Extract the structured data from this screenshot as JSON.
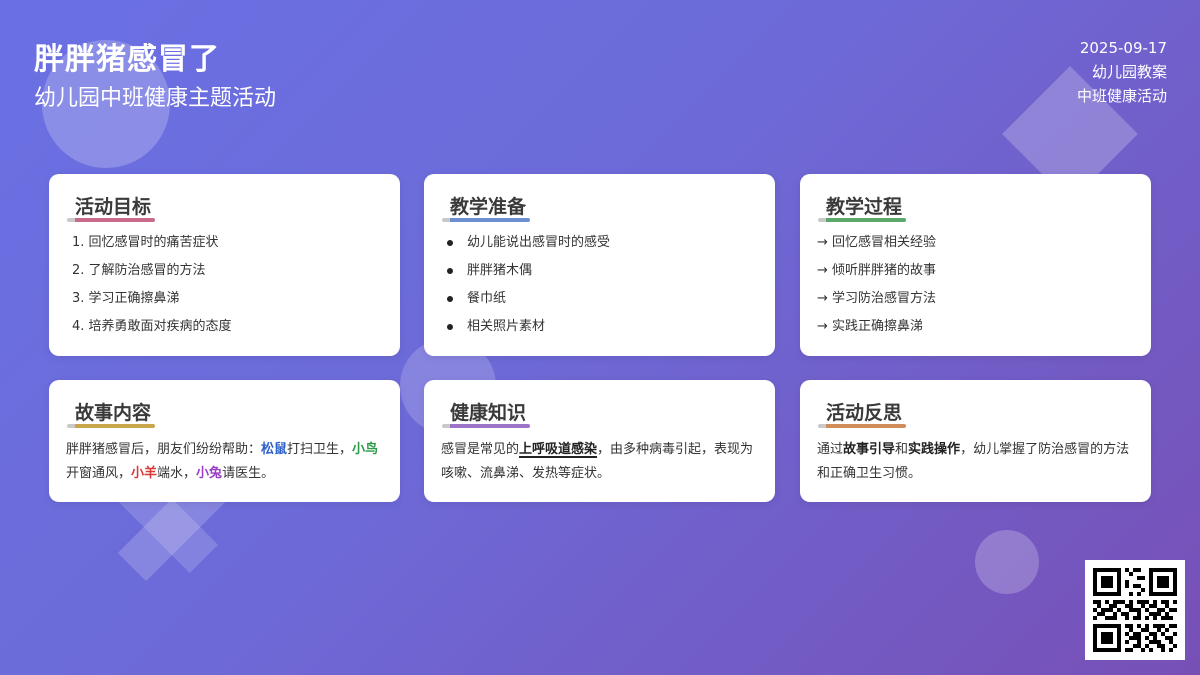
{
  "header": {
    "title": "胖胖猪感冒了",
    "subtitle": "幼儿园中班健康主题活动"
  },
  "meta": {
    "date": "2025-09-17",
    "type": "幼儿园教案",
    "category": "中班健康活动"
  },
  "cards": {
    "goals": {
      "title": "活动目标",
      "items": [
        "1. 回忆感冒时的痛苦症状",
        "2. 了解防治感冒的方法",
        "3. 学习正确擦鼻涕",
        "4. 培养勇敢面对疾病的态度"
      ]
    },
    "prep": {
      "title": "教学准备",
      "items": [
        "幼儿能说出感冒时的感受",
        "胖胖猪木偶",
        "餐巾纸",
        "相关照片素材"
      ]
    },
    "process": {
      "title": "教学过程",
      "items": [
        "→ 回忆感冒相关经验",
        "→ 倾听胖胖猪的故事",
        "→ 学习防治感冒方法",
        "→ 实践正确擦鼻涕"
      ]
    },
    "story": {
      "title": "故事内容",
      "t1": "胖胖猪感冒后，朋友们纷纷帮助：",
      "squirrel": "松鼠",
      "t2": "打扫卫生，",
      "bird": "小鸟",
      "t3": "开窗通风，",
      "sheep": "小羊",
      "t4": "端水，",
      "rabbit": "小兔",
      "t5": "请医生。"
    },
    "knowledge": {
      "title": "健康知识",
      "t1": "感冒是常见的",
      "highlight": "上呼吸道感染",
      "t2": "，由多种病毒引起，表现为咳嗽、流鼻涕、发热等症状。"
    },
    "reflection": {
      "title": "活动反思",
      "t1": "通过",
      "k1": "故事引导",
      "t2": "和",
      "k2": "实践操作",
      "t3": "，幼儿掌握了防治感冒的方法和正确卫生习惯。"
    }
  },
  "qr": {
    "icon": "qr-code-icon"
  }
}
